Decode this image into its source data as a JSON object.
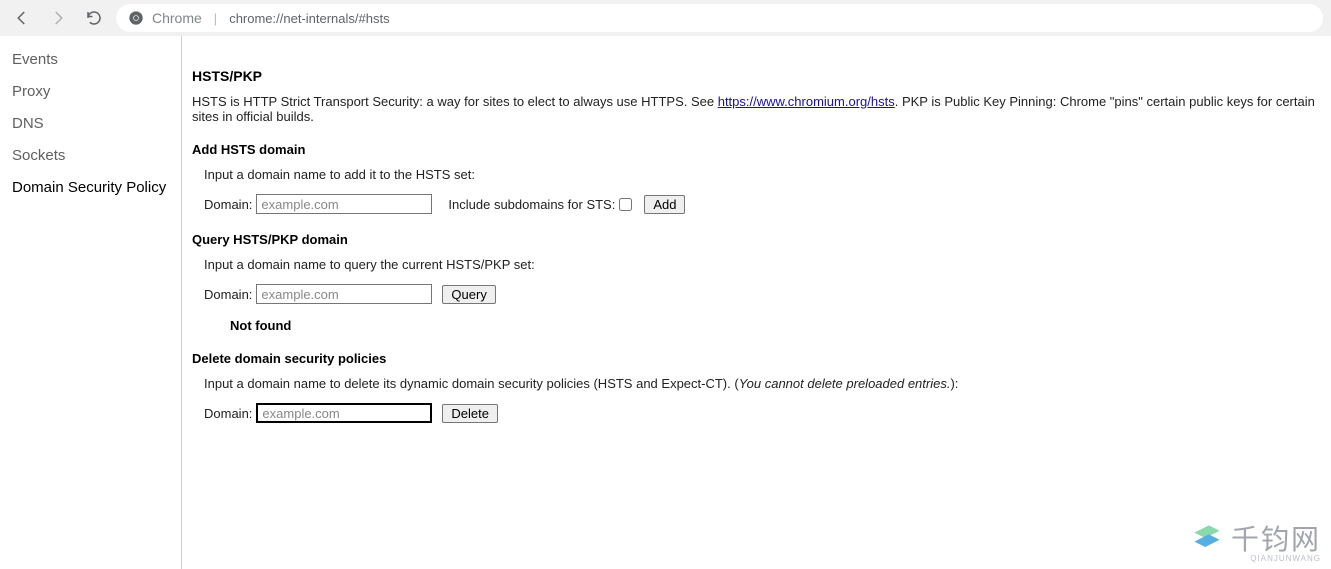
{
  "browser": {
    "address_label": "Chrome",
    "address_url": "chrome://net-internals/#hsts"
  },
  "sidebar": {
    "items": [
      {
        "label": "Events"
      },
      {
        "label": "Proxy"
      },
      {
        "label": "DNS"
      },
      {
        "label": "Sockets"
      },
      {
        "label": "Domain Security Policy"
      }
    ]
  },
  "page": {
    "title": "HSTS/PKP",
    "intro_a": "HSTS is HTTP Strict Transport Security: a way for sites to elect to always use HTTPS. See ",
    "intro_link": "https://www.chromium.org/hsts",
    "intro_b": ". PKP is Public Key Pinning: Chrome \"pins\" certain public keys for certain sites in official builds.",
    "add": {
      "heading": "Add HSTS domain",
      "help": "Input a domain name to add it to the HSTS set:",
      "domain_label": "Domain:",
      "placeholder": "example.com",
      "value": "",
      "include_label": "Include subdomains for STS:",
      "add_btn": "Add"
    },
    "query": {
      "heading": "Query HSTS/PKP domain",
      "help": "Input a domain name to query the current HSTS/PKP set:",
      "domain_label": "Domain:",
      "placeholder": "example.com",
      "value": "",
      "query_btn": "Query",
      "result": "Not found"
    },
    "delete": {
      "heading": "Delete domain security policies",
      "help_a": "Input a domain name to delete its dynamic domain security policies (HSTS and Expect-CT). (",
      "help_italic": "You cannot delete preloaded entries.",
      "help_b": "):",
      "domain_label": "Domain:",
      "placeholder": "example.com",
      "value": "",
      "delete_btn": "Delete"
    }
  },
  "watermark": {
    "text": "千钧网",
    "sub": "QIANJUNWANG"
  }
}
